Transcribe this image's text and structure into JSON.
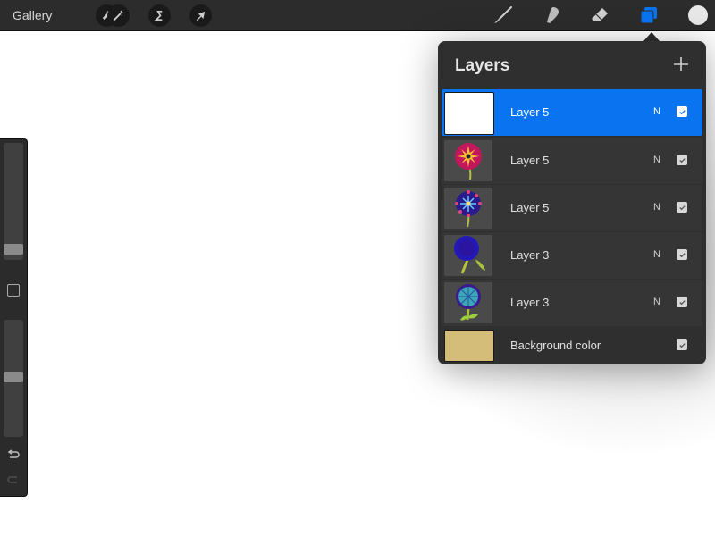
{
  "toolbar": {
    "gallery_label": "Gallery",
    "left_tools": [
      {
        "name": "actions",
        "icon": "wrench-icon"
      },
      {
        "name": "adjustments",
        "icon": "magic-wand-icon"
      },
      {
        "name": "selection",
        "icon": "selection-s-icon"
      },
      {
        "name": "transform",
        "icon": "arrow-cursor-icon"
      }
    ],
    "right_tools": [
      {
        "name": "brush",
        "icon": "brush-icon"
      },
      {
        "name": "smudge",
        "icon": "smudge-finger-icon"
      },
      {
        "name": "eraser",
        "icon": "eraser-icon"
      },
      {
        "name": "layers",
        "icon": "layers-icon",
        "active": true
      }
    ],
    "current_color": "#e8e8e8",
    "active_color": "#0a74f0"
  },
  "layers_panel": {
    "title": "Layers",
    "add_icon": "plus-icon",
    "layers": [
      {
        "name": "Layer 5",
        "blend_mode": "N",
        "visible": true,
        "selected": true,
        "thumbnail": "blank-white"
      },
      {
        "name": "Layer 5",
        "blend_mode": "N",
        "visible": true,
        "selected": false,
        "thumbnail": "red-yellow-flower"
      },
      {
        "name": "Layer 5",
        "blend_mode": "N",
        "visible": true,
        "selected": false,
        "thumbnail": "blue-star-flower"
      },
      {
        "name": "Layer 3",
        "blend_mode": "N",
        "visible": true,
        "selected": false,
        "thumbnail": "blue-round-flower"
      },
      {
        "name": "Layer 3",
        "blend_mode": "N",
        "visible": true,
        "selected": false,
        "thumbnail": "teal-flower"
      }
    ],
    "background": {
      "name": "Background color",
      "visible": true,
      "color": "#d4bd78"
    }
  },
  "sidebar": {
    "brush_size_level": 0.87,
    "opacity_level": 0.5,
    "modify_icon": "square-icon",
    "undo_icon": "undo-icon",
    "redo_icon": "redo-icon"
  }
}
